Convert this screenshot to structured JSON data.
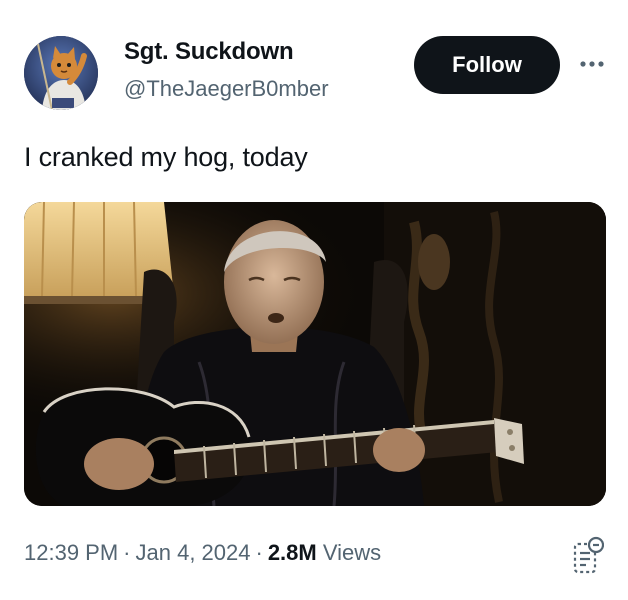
{
  "author": {
    "display_name": "Sgt. Suckdown",
    "handle": "@TheJaegerB0mber",
    "avatar_icon": "cartoon-cat-avatar"
  },
  "actions": {
    "follow_label": "Follow",
    "more_icon": "more-dots-icon"
  },
  "tweet": {
    "text": "I cranked my hog, today",
    "media_description_icon": "video-still-man-playing-guitar"
  },
  "meta": {
    "time": "12:39 PM",
    "separator": "·",
    "date": "Jan 4, 2024",
    "views_count": "2.8M",
    "views_label": "Views",
    "reader_icon": "reader-mode-icon"
  },
  "colors": {
    "text_primary": "#0f1419",
    "text_secondary": "#536471",
    "follow_bg": "#0f1419",
    "follow_text": "#ffffff"
  }
}
